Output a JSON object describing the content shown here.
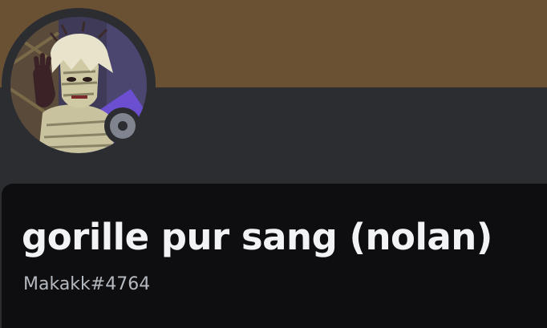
{
  "profile": {
    "display_name": "gorille pur sang (nolan)",
    "username": "Makakk#4764",
    "status": "offline",
    "avatar_icon": "anime-character-avatar"
  },
  "colors": {
    "banner": "#6b5134",
    "background": "#2b2d31",
    "card": "#0e0e10",
    "status_offline": "#80848e",
    "name_text": "#f2f3f5",
    "username_text": "#b5bac1"
  }
}
